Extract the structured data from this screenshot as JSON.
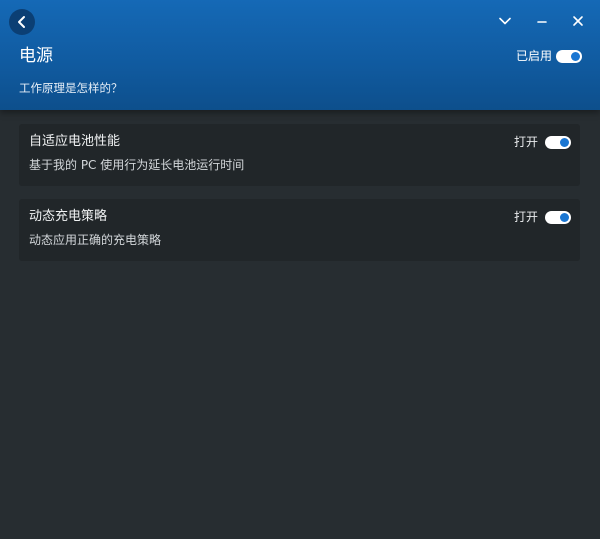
{
  "header": {
    "title": "电源",
    "status_label": "已启用",
    "how_it_works_link": "工作原理是怎样的？",
    "toggle_on": true
  },
  "window_controls": {
    "back_icon": "chevron-left-icon",
    "collapse_icon": "chevron-down-icon",
    "minimize_icon": "minimize-icon",
    "close_icon": "close-icon"
  },
  "cards": [
    {
      "title": "自适应电池性能",
      "description": "基于我的 PC 使用行为延长电池运行时间",
      "state_label": "打开",
      "toggle_on": true
    },
    {
      "title": "动态充电策略",
      "description": "动态应用正确的充电策略",
      "state_label": "打开",
      "toggle_on": true
    }
  ],
  "colors": {
    "header_blue": "#1569b6",
    "background": "#272d31",
    "card": "#212629",
    "toggle_knob": "#1a76d2"
  }
}
